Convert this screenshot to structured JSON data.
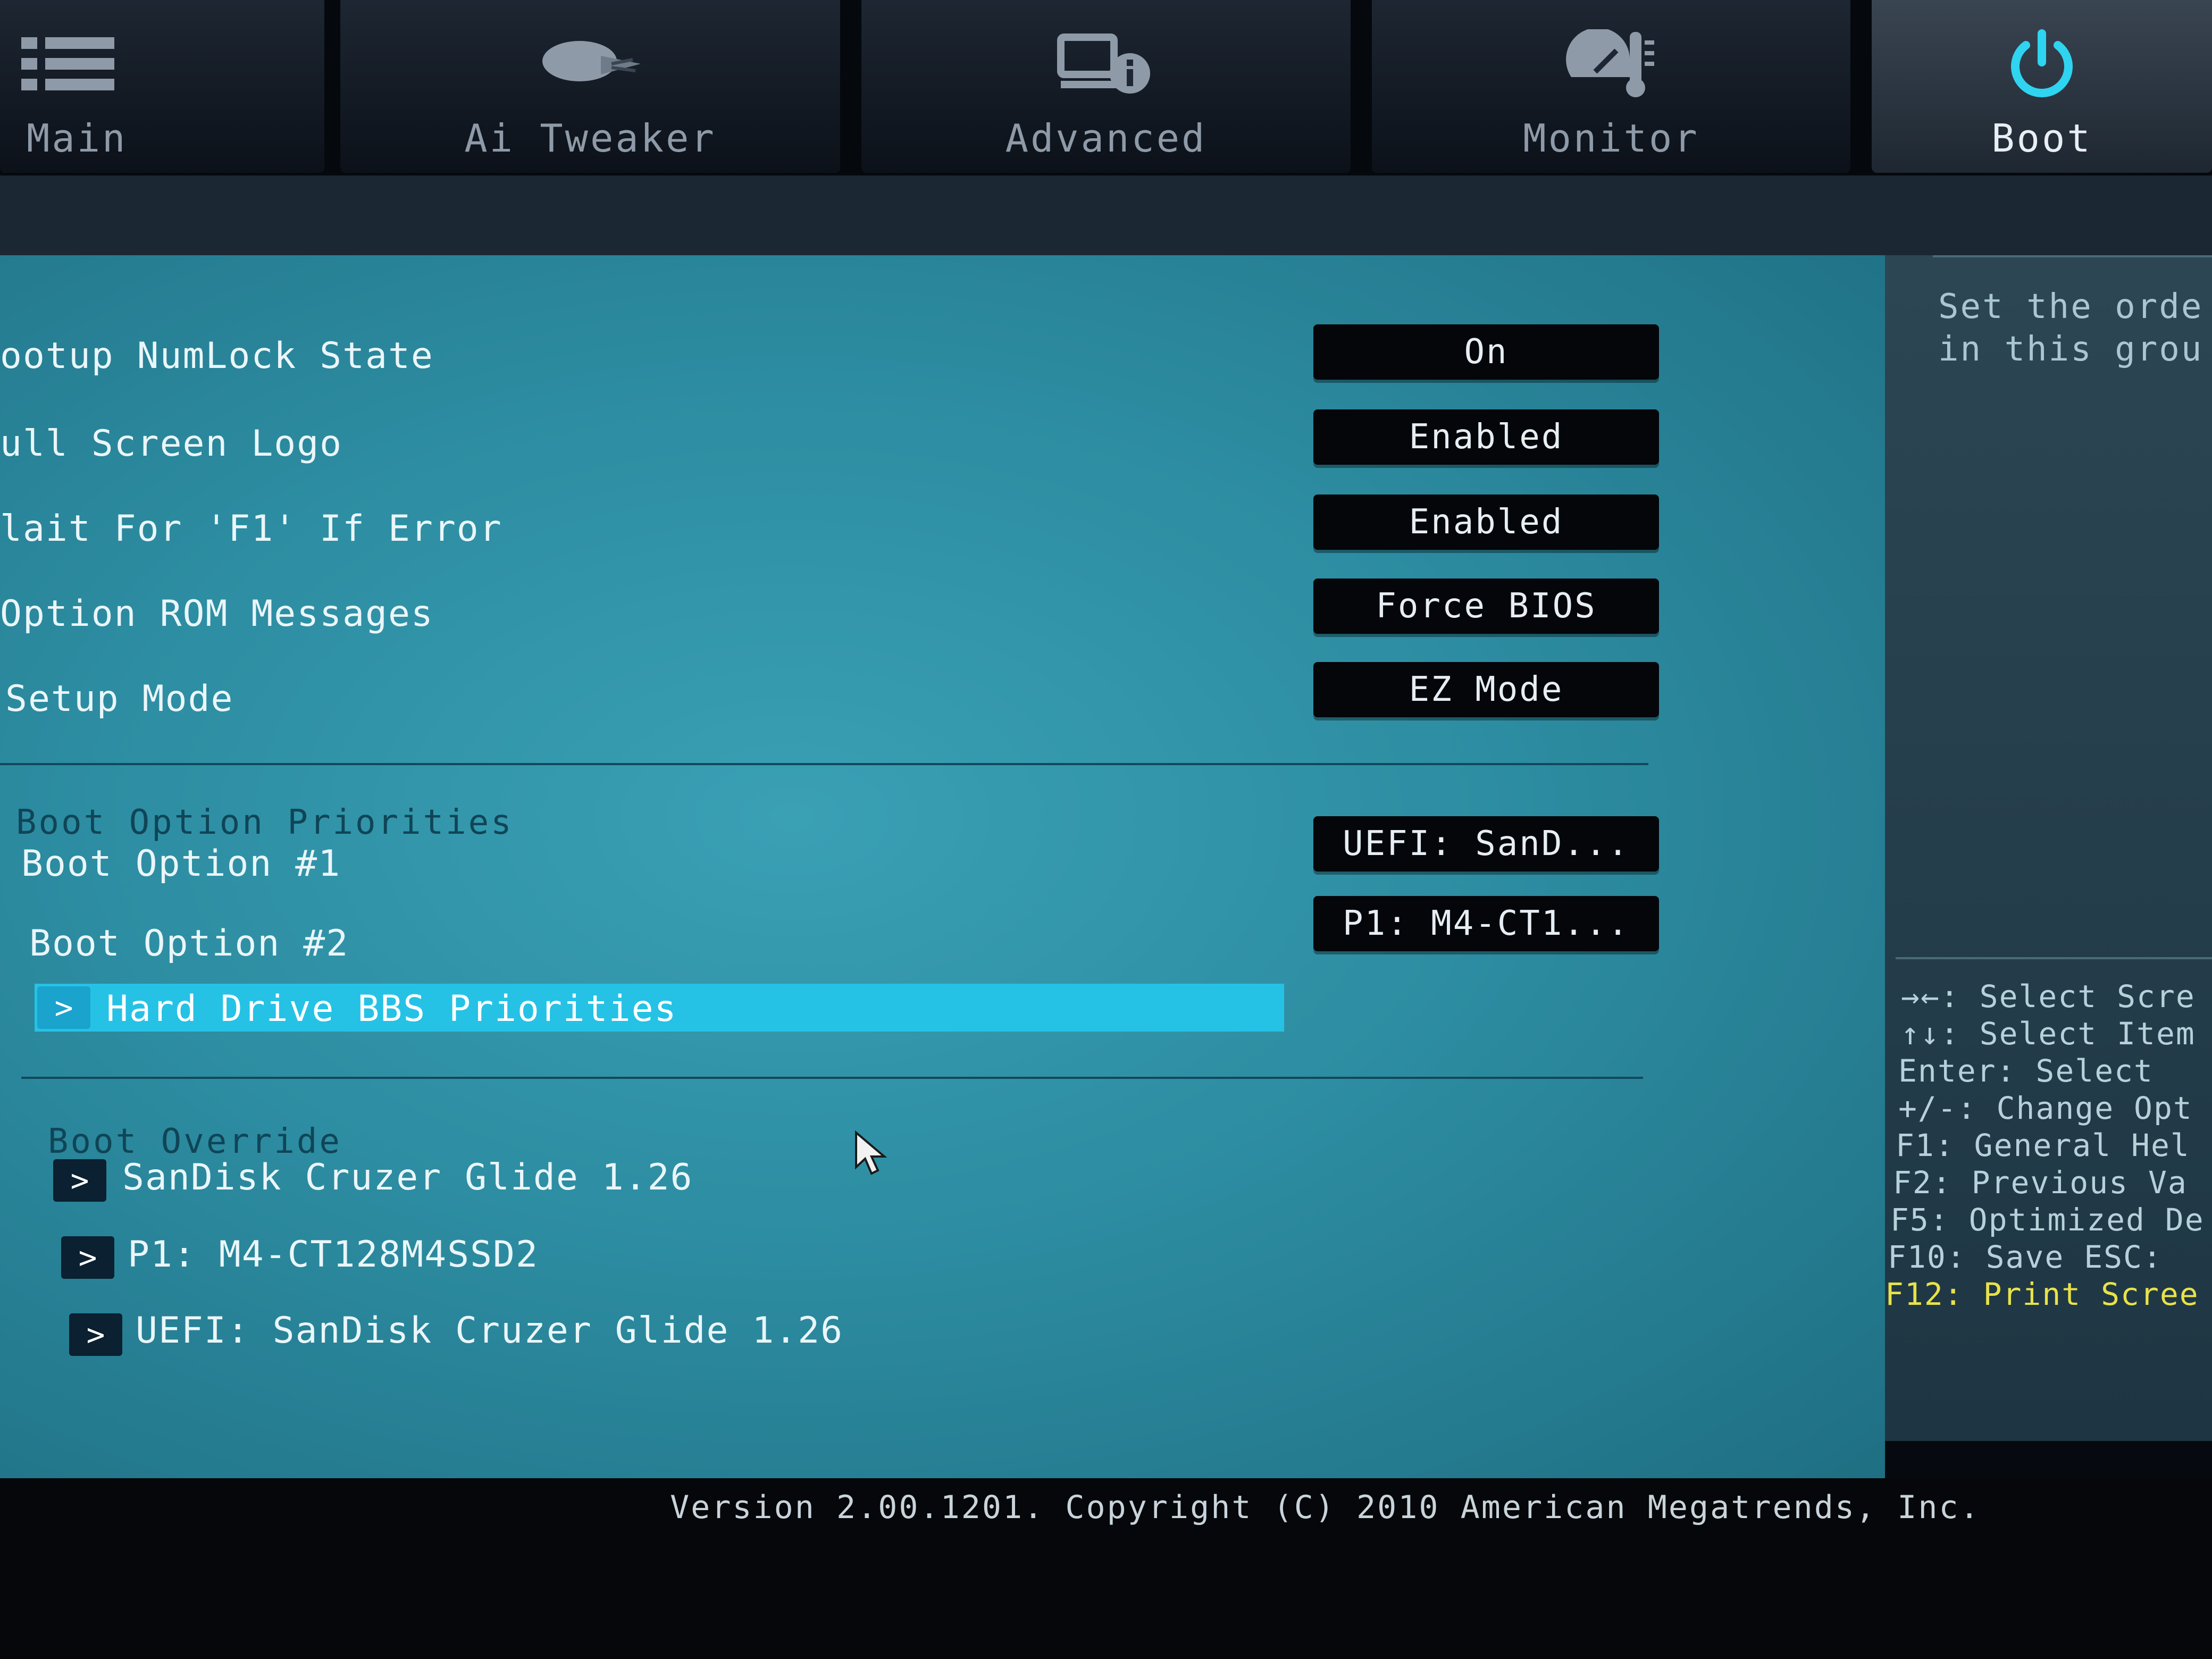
{
  "tabs": [
    {
      "label": "Main",
      "icon": "list-icon"
    },
    {
      "label": "Ai Tweaker",
      "icon": "rocket-icon"
    },
    {
      "label": "Advanced",
      "icon": "settings-info-icon"
    },
    {
      "label": "Monitor",
      "icon": "gauge-icon"
    },
    {
      "label": "Boot",
      "icon": "power-icon"
    }
  ],
  "settings": [
    {
      "label": "ootup NumLock State",
      "value": "On"
    },
    {
      "label": "ull Screen Logo",
      "value": "Enabled"
    },
    {
      "label": "lait For 'F1' If Error",
      "value": "Enabled"
    },
    {
      "label": "Option ROM Messages",
      "value": "Force BIOS"
    },
    {
      "label": "Setup Mode",
      "value": "EZ Mode"
    }
  ],
  "boot_priorities": {
    "header": "Boot Option Priorities",
    "options": [
      {
        "label": "Boot Option #1",
        "value": "UEFI: SanD..."
      },
      {
        "label": "Boot Option #2",
        "value": "P1: M4-CT1..."
      }
    ],
    "submenu": "Hard Drive BBS Priorities"
  },
  "boot_override": {
    "header": "Boot Override",
    "items": [
      "SanDisk Cruzer Glide 1.26",
      "P1: M4-CT128M4SSD2",
      "UEFI: SanDisk Cruzer Glide 1.26"
    ]
  },
  "help": {
    "lines": [
      "Set the orde",
      "in this grou"
    ],
    "keys": [
      "→←: Select Scre",
      "↑↓: Select Item",
      "Enter: Select",
      "+/-: Change Opt",
      "F1: General Hel",
      "F2: Previous Va",
      "F5: Optimized De",
      "F10: Save  ESC:",
      "F12: Print Scree"
    ]
  },
  "footer": {
    "version": "Version 2.00.1201. Copyright (C) 2010 American Megatrends, Inc."
  },
  "colors": {
    "panel": "#2d8da2",
    "highlight": "#25c2e6",
    "value_box": "#04060a",
    "f12_key": "#e8e24a"
  }
}
